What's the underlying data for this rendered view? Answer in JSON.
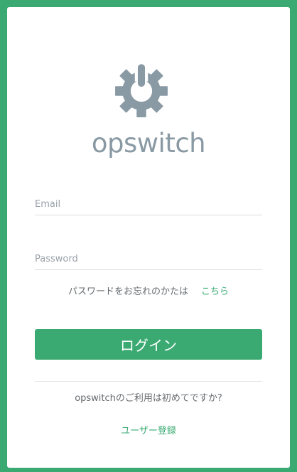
{
  "colors": {
    "background": "#3aaa72",
    "card": "#ffffff",
    "accent": "#3aaa72",
    "logo": "#8a9aa4"
  },
  "logo": {
    "icon": "power-gear-icon",
    "text": "opswitch"
  },
  "form": {
    "email_placeholder": "Email",
    "email_value": "",
    "password_placeholder": "Password",
    "password_value": "",
    "forgot_text": "パスワードをお忘れのかたは",
    "forgot_link": "こちら",
    "login_label": "ログイン"
  },
  "footer": {
    "first_time_text": "opswitchのご利用は初めてですか?",
    "signup_link": "ユーザー登録"
  }
}
